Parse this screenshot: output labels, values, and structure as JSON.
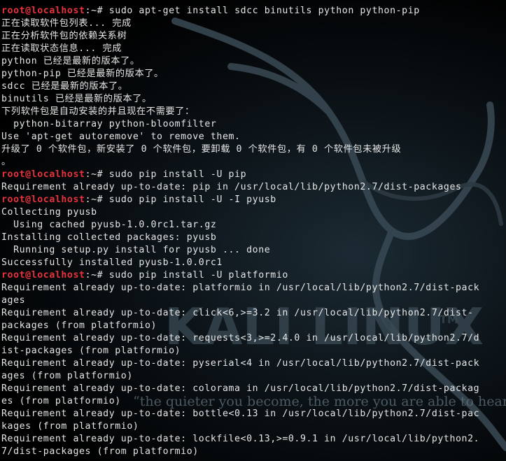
{
  "wallpaper": {
    "brand": "KALI LINUX",
    "trademark": "TM",
    "quote": "“the quieter you become, the more you are able to hear”",
    "colors": {
      "logo": "#3a4a55",
      "quote": "#5d6d78"
    }
  },
  "terminal": {
    "prompt_color": "#e8323c",
    "text_color": "#e6e6e6",
    "lines": [
      {
        "type": "prompt",
        "user": "root@localhost",
        "sep": ":~# ",
        "cmd": "sudo apt-get install sdcc binutils python python-pip"
      },
      {
        "type": "out",
        "text": "正在读取软件包列表... 完成"
      },
      {
        "type": "out",
        "text": "正在分析软件包的依赖关系树"
      },
      {
        "type": "out",
        "text": "正在读取状态信息... 完成"
      },
      {
        "type": "out",
        "text": "python 已经是最新的版本了。"
      },
      {
        "type": "out",
        "text": "python-pip 已经是最新的版本了。"
      },
      {
        "type": "out",
        "text": "sdcc 已经是最新的版本了。"
      },
      {
        "type": "out",
        "text": "binutils 已经是最新的版本了。"
      },
      {
        "type": "out",
        "text": "下列软件包是自动安装的并且现在不需要了："
      },
      {
        "type": "out",
        "text": "  python-bitarray python-bloomfilter"
      },
      {
        "type": "out",
        "text": "Use 'apt-get autoremove' to remove them."
      },
      {
        "type": "out",
        "text": "升级了 0 个软件包，新安装了 0 个软件包，要卸载 0 个软件包，有 0 个软件包未被升级"
      },
      {
        "type": "out",
        "text": "。"
      },
      {
        "type": "prompt",
        "user": "root@localhost",
        "sep": ":~# ",
        "cmd": "sudo pip install -U pip"
      },
      {
        "type": "out",
        "text": "Requirement already up-to-date: pip in /usr/local/lib/python2.7/dist-packages"
      },
      {
        "type": "prompt",
        "user": "root@localhost",
        "sep": ":~# ",
        "cmd": "sudo pip install -U -I pyusb"
      },
      {
        "type": "out",
        "text": "Collecting pyusb"
      },
      {
        "type": "out",
        "text": "  Using cached pyusb-1.0.0rc1.tar.gz"
      },
      {
        "type": "out",
        "text": "Installing collected packages: pyusb"
      },
      {
        "type": "out",
        "text": "  Running setup.py install for pyusb ... done"
      },
      {
        "type": "out",
        "text": "Successfully installed pyusb-1.0.0rc1"
      },
      {
        "type": "prompt",
        "user": "root@localhost",
        "sep": ":~# ",
        "cmd": "sudo pip install -U platformio"
      },
      {
        "type": "out",
        "text": "Requirement already up-to-date: platformio in /usr/local/lib/python2.7/dist-pack"
      },
      {
        "type": "out",
        "text": "ages"
      },
      {
        "type": "out",
        "text": "Requirement already up-to-date: click<6,>=3.2 in /usr/local/lib/python2.7/dist-"
      },
      {
        "type": "out",
        "text": "packages (from platformio)"
      },
      {
        "type": "out",
        "text": "Requirement already up-to-date: requests<3,>=2.4.0 in /usr/local/lib/python2.7/d"
      },
      {
        "type": "out",
        "text": "ist-packages (from platformio)"
      },
      {
        "type": "out",
        "text": "Requirement already up-to-date: pyserial<4 in /usr/local/lib/python2.7/dist-pack"
      },
      {
        "type": "out",
        "text": "ages (from platformio)"
      },
      {
        "type": "out",
        "text": "Requirement already up-to-date: colorama in /usr/local/lib/python2.7/dist-packag"
      },
      {
        "type": "out",
        "text": "es (from platformio)"
      },
      {
        "type": "out",
        "text": "Requirement already up-to-date: bottle<0.13 in /usr/local/lib/python2.7/dist-pac"
      },
      {
        "type": "out",
        "text": "kages (from platformio)"
      },
      {
        "type": "out",
        "text": "Requirement already up-to-date: lockfile<0.13,>=0.9.1 in /usr/local/lib/python2."
      },
      {
        "type": "out",
        "text": "7/dist-packages (from platformio)"
      }
    ]
  }
}
